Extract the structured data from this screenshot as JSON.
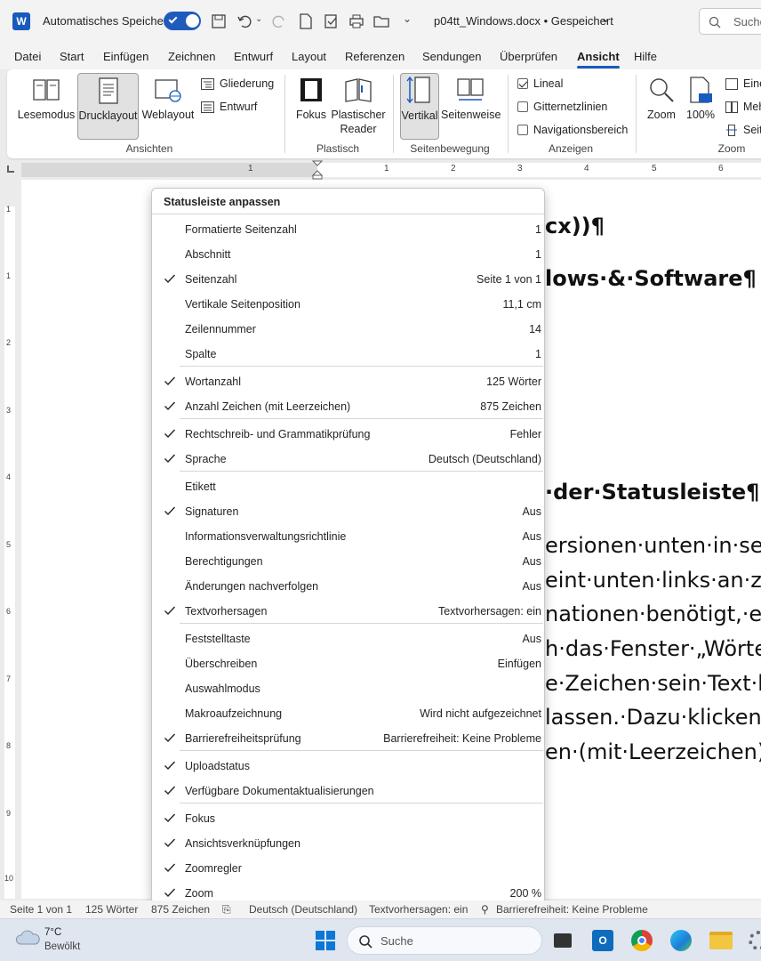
{
  "titlebar": {
    "autosave_label": "Automatisches Speichern",
    "doc_title": "p04tt_Windows.docx • Gespeichert",
    "search_placeholder": "Suche"
  },
  "tabs": [
    "Datei",
    "Start",
    "Einfügen",
    "Zeichnen",
    "Entwurf",
    "Layout",
    "Referenzen",
    "Sendungen",
    "Überprüfen",
    "Ansicht",
    "Hilfe"
  ],
  "active_tab": "Ansicht",
  "ribbon": {
    "ansichten": {
      "lesemodus": "Lesemodus",
      "drucklayout": "Drucklayout",
      "weblayout": "Weblayout",
      "gliederung": "Gliederung",
      "entwurf": "Entwurf",
      "group": "Ansichten"
    },
    "plastisch": {
      "fokus": "Fokus",
      "reader_line1": "Plastischer",
      "reader_line2": "Reader",
      "group": "Plastisch"
    },
    "seitenbewegung": {
      "vertikal": "Vertikal",
      "seitenweise": "Seitenweise",
      "group": "Seitenbewegung"
    },
    "anzeigen": {
      "lineal": "Lineal",
      "gitternetz": "Gitternetzlinien",
      "navigation": "Navigationsbereich",
      "group": "Anzeigen"
    },
    "zoom": {
      "zoom": "Zoom",
      "pct": "100%",
      "eine": "Eine",
      "mehr": "Meh",
      "seit": "Seit",
      "group": "Zoom"
    }
  },
  "ruler_numbers": [
    "1",
    "1",
    "2",
    "3",
    "4",
    "5",
    "6"
  ],
  "vruler_numbers": [
    "1",
    "1",
    "2",
    "3",
    "4",
    "5",
    "6",
    "7",
    "8",
    "9",
    "10"
  ],
  "document": {
    "line1": "cx))¶",
    "line2": "lows·&·Software¶",
    "line3": "·der·Statusleiste¶",
    "p1": "ersionen·unten·in·sei",
    "p2": "eint·unten·links·an·zw",
    "p3": "nationen·benötigt,·etw",
    "p4": "h·das·Fenster·„Wörte",
    "p5": "e·Zeichen·sein·Text·h",
    "p6": "lassen.·Dazu·klicken·",
    "p7": "en·(mit·Leerzeichen)"
  },
  "menu": {
    "title": "Statusleiste anpassen",
    "items": [
      {
        "label": "Formatierte Seitenzahl",
        "value": "1",
        "checked": false
      },
      {
        "label": "Abschnitt",
        "value": "1",
        "checked": false
      },
      {
        "label": "Seitenzahl",
        "value": "Seite 1 von 1",
        "checked": true
      },
      {
        "label": "Vertikale Seitenposition",
        "value": "11,1 cm",
        "checked": false
      },
      {
        "label": "Zeilennummer",
        "value": "14",
        "checked": false
      },
      {
        "label": "Spalte",
        "value": "1",
        "checked": false
      },
      {
        "label": "Wortanzahl",
        "value": "125 Wörter",
        "checked": true
      },
      {
        "label": "Anzahl Zeichen (mit Leerzeichen)",
        "value": "875 Zeichen",
        "checked": true
      },
      {
        "label": "Rechtschreib- und Grammatikprüfung",
        "value": "Fehler",
        "checked": true
      },
      {
        "label": "Sprache",
        "value": "Deutsch (Deutschland)",
        "checked": true
      },
      {
        "label": "Etikett",
        "value": "",
        "checked": false
      },
      {
        "label": "Signaturen",
        "value": "Aus",
        "checked": true
      },
      {
        "label": "Informationsverwaltungsrichtlinie",
        "value": "Aus",
        "checked": false
      },
      {
        "label": "Berechtigungen",
        "value": "Aus",
        "checked": false
      },
      {
        "label": "Änderungen nachverfolgen",
        "value": "Aus",
        "checked": false
      },
      {
        "label": "Textvorhersagen",
        "value": "Textvorhersagen: ein",
        "checked": true
      },
      {
        "label": "Feststelltaste",
        "value": "Aus",
        "checked": false
      },
      {
        "label": "Überschreiben",
        "value": "Einfügen",
        "checked": false
      },
      {
        "label": "Auswahlmodus",
        "value": "",
        "checked": false
      },
      {
        "label": "Makroaufzeichnung",
        "value": "Wird nicht aufgezeichnet",
        "checked": false
      },
      {
        "label": "Barrierefreiheitsprüfung",
        "value": "Barrierefreiheit: Keine Probleme",
        "checked": true
      },
      {
        "label": "Uploadstatus",
        "value": "",
        "checked": true
      },
      {
        "label": "Verfügbare Dokumentaktualisierungen",
        "value": "",
        "checked": true
      },
      {
        "label": "Fokus",
        "value": "",
        "checked": true
      },
      {
        "label": "Ansichtsverknüpfungen",
        "value": "",
        "checked": true
      },
      {
        "label": "Zoomregler",
        "value": "",
        "checked": true
      },
      {
        "label": "Zoom",
        "value": "200 %",
        "checked": true
      }
    ]
  },
  "statusbar": {
    "page": "Seite 1 von 1",
    "words": "125 Wörter",
    "chars": "875 Zeichen",
    "lang": "Deutsch (Deutschland)",
    "predict": "Textvorhersagen: ein",
    "access": "Barrierefreiheit: Keine Probleme"
  },
  "taskbar": {
    "temp": "7°C",
    "weather": "Bewölkt",
    "search": "Suche"
  },
  "colors": {
    "accent": "#185abd",
    "toggle": "#1f5bbd"
  }
}
